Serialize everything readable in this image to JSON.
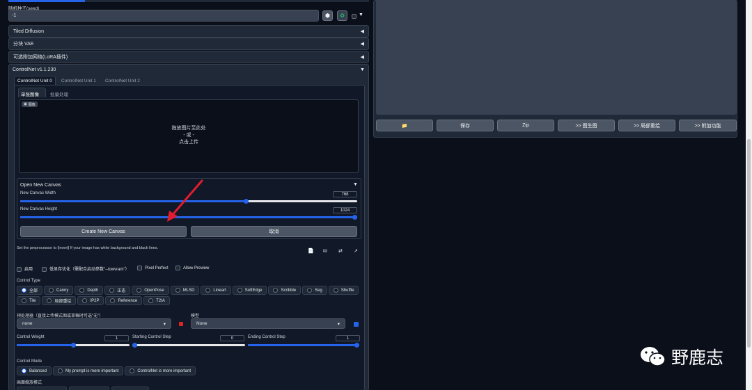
{
  "seed": {
    "label": "随机种子(seed)",
    "value": "-1"
  },
  "accordions": {
    "tiled_diffusion": "Tiled Diffusion",
    "tiled_vae": "分块 VAE",
    "lora": "可选附加网络(LoRA插件)",
    "controlnet": "ControlNet v1.1.230"
  },
  "cn_tabs": [
    "ControlNet Unit 0",
    "ControlNet Unit 1",
    "ControlNet Unit 2"
  ],
  "img_tabs": [
    "单张图像",
    "批量处理"
  ],
  "image": {
    "badge": "图像",
    "drop1": "拖放图片至此处",
    "drop2": "- 或 -",
    "drop3": "点击上传"
  },
  "canvas": {
    "title": "Open New Canvas",
    "width_label": "New Canvas Width",
    "width_value": "768",
    "width_frac": 0.67,
    "height_label": "New Canvas Height",
    "height_value": "1024",
    "height_frac": 1.0,
    "create": "Create New Canvas",
    "cancel": "取消"
  },
  "hint": "Set the preprocessor to [invert] If your image has white background and black lines.",
  "options": [
    "启用",
    "低显存优化（需配合启动参数\"--lowvram\"）",
    "Pixel Perfect",
    "Allow Preview"
  ],
  "control_type": {
    "label": "Control Type",
    "items": [
      "全部",
      "Canny",
      "Depth",
      "正态",
      "OpenPose",
      "MLSD",
      "Lineart",
      "SoftEdge",
      "Scribble",
      "Seg",
      "Shuffle",
      "Tile",
      "局部重绘",
      "IP2P",
      "Reference",
      "T2IA"
    ]
  },
  "preprocessor": {
    "label": "预处理器（直接上传模式图或草稿时可选\"无\"）",
    "value": "none"
  },
  "model": {
    "label": "模型",
    "value": "None"
  },
  "weight": {
    "label": "Control Weight",
    "value": "1",
    "frac": 0.5
  },
  "start": {
    "label": "Starting Control Step",
    "value": "0",
    "frac": 0.0
  },
  "end": {
    "label": "Ending Control Step",
    "value": "1",
    "frac": 1.0
  },
  "mode": {
    "label": "Control Mode",
    "items": [
      "Balanced",
      "My prompt is more important",
      "ControlNet is more important"
    ]
  },
  "resize_label": "画面缩放模式",
  "output_buttons": [
    "📁",
    "保存",
    "Zip",
    ">> 图生图",
    ">> 局部重绘",
    ">> 附加功能"
  ],
  "watermark": "野鹿志"
}
